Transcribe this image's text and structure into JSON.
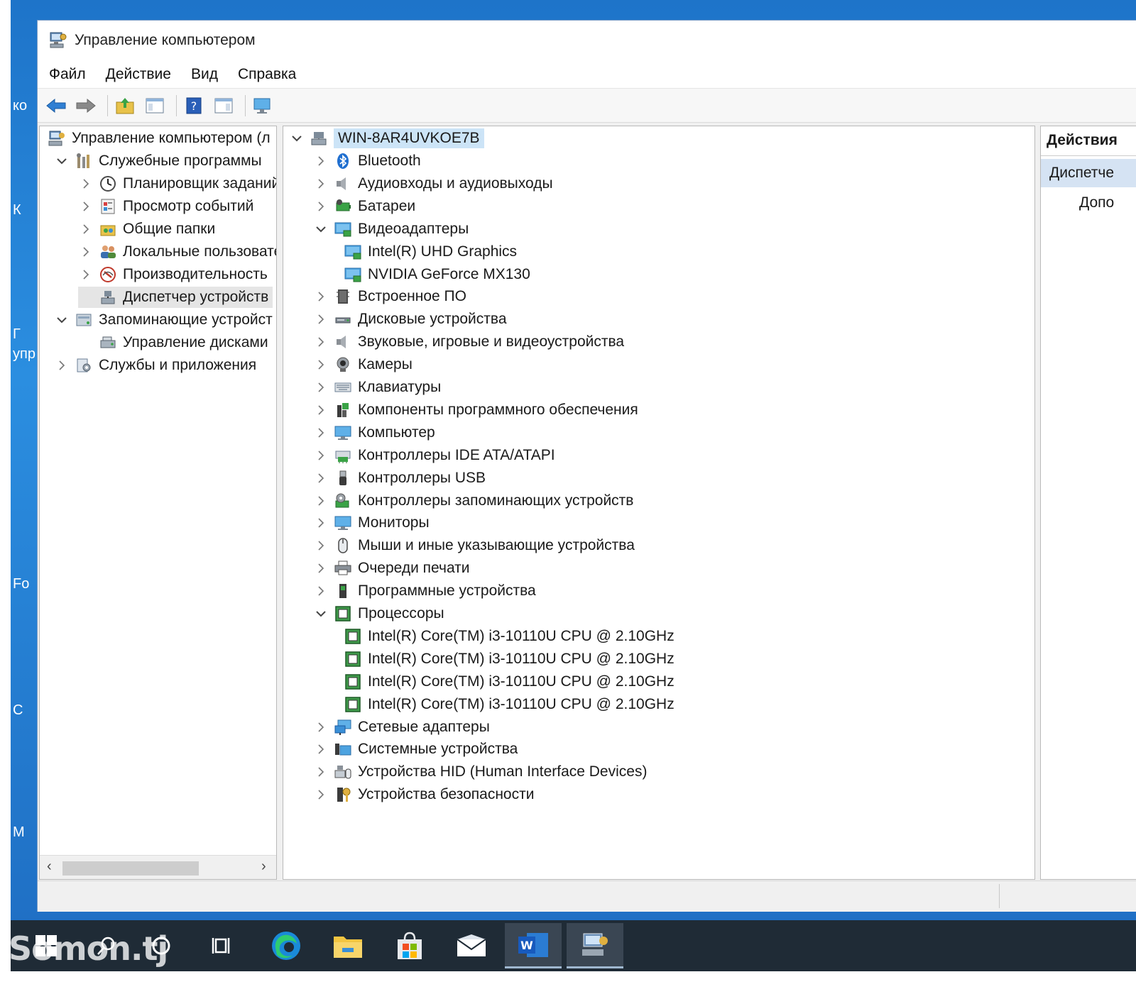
{
  "window": {
    "title": "Управление компьютером"
  },
  "menu": [
    "Файл",
    "Действие",
    "Вид",
    "Справка"
  ],
  "left_tree": [
    {
      "label": "Управление компьютером (л",
      "depth": 0,
      "expander": "none",
      "icon": "computer-management-icon"
    },
    {
      "label": "Служебные программы",
      "depth": 1,
      "expander": "expanded",
      "icon": "tools-icon"
    },
    {
      "label": "Планировщик заданий",
      "depth": 2,
      "expander": "collapsed",
      "icon": "clock-icon"
    },
    {
      "label": "Просмотр событий",
      "depth": 2,
      "expander": "collapsed",
      "icon": "event-viewer-icon"
    },
    {
      "label": "Общие папки",
      "depth": 2,
      "expander": "collapsed",
      "icon": "shared-folders-icon"
    },
    {
      "label": "Локальные пользовате",
      "depth": 2,
      "expander": "collapsed",
      "icon": "users-icon"
    },
    {
      "label": "Производительность",
      "depth": 2,
      "expander": "collapsed",
      "icon": "performance-icon"
    },
    {
      "label": "Диспетчер устройств",
      "depth": 2,
      "expander": "none",
      "icon": "device-manager-icon",
      "selected": true
    },
    {
      "label": "Запоминающие устройст",
      "depth": 1,
      "expander": "expanded",
      "icon": "storage-icon"
    },
    {
      "label": "Управление дисками",
      "depth": 2,
      "expander": "none",
      "icon": "disk-management-icon"
    },
    {
      "label": "Службы и приложения",
      "depth": 1,
      "expander": "collapsed",
      "icon": "services-icon"
    }
  ],
  "device_tree": {
    "root": "WIN-8AR4UVKOE7B",
    "items": [
      {
        "label": "Bluetooth",
        "depth": 1,
        "expander": "collapsed",
        "icon": "bluetooth-icon"
      },
      {
        "label": "Аудиовходы и аудиовыходы",
        "depth": 1,
        "expander": "collapsed",
        "icon": "speaker-icon"
      },
      {
        "label": "Батареи",
        "depth": 1,
        "expander": "collapsed",
        "icon": "battery-icon"
      },
      {
        "label": "Видеоадаптеры",
        "depth": 1,
        "expander": "expanded",
        "icon": "display-adapter-icon"
      },
      {
        "label": "Intel(R) UHD Graphics",
        "depth": 2,
        "expander": "none",
        "icon": "display-adapter-icon"
      },
      {
        "label": "NVIDIA GeForce MX130",
        "depth": 2,
        "expander": "none",
        "icon": "display-adapter-icon"
      },
      {
        "label": "Встроенное ПО",
        "depth": 1,
        "expander": "collapsed",
        "icon": "firmware-icon"
      },
      {
        "label": "Дисковые устройства",
        "depth": 1,
        "expander": "collapsed",
        "icon": "disk-drive-icon"
      },
      {
        "label": "Звуковые, игровые и видеоустройства",
        "depth": 1,
        "expander": "collapsed",
        "icon": "speaker-icon"
      },
      {
        "label": "Камеры",
        "depth": 1,
        "expander": "collapsed",
        "icon": "camera-icon"
      },
      {
        "label": "Клавиатуры",
        "depth": 1,
        "expander": "collapsed",
        "icon": "keyboard-icon"
      },
      {
        "label": "Компоненты программного обеспечения",
        "depth": 1,
        "expander": "collapsed",
        "icon": "software-component-icon"
      },
      {
        "label": "Компьютер",
        "depth": 1,
        "expander": "collapsed",
        "icon": "monitor-icon"
      },
      {
        "label": "Контроллеры IDE ATA/ATAPI",
        "depth": 1,
        "expander": "collapsed",
        "icon": "ide-controller-icon"
      },
      {
        "label": "Контроллеры USB",
        "depth": 1,
        "expander": "collapsed",
        "icon": "usb-icon"
      },
      {
        "label": "Контроллеры запоминающих устройств",
        "depth": 1,
        "expander": "collapsed",
        "icon": "storage-controller-icon"
      },
      {
        "label": "Мониторы",
        "depth": 1,
        "expander": "collapsed",
        "icon": "monitor-icon"
      },
      {
        "label": "Мыши и иные указывающие устройства",
        "depth": 1,
        "expander": "collapsed",
        "icon": "mouse-icon"
      },
      {
        "label": "Очереди печати",
        "depth": 1,
        "expander": "collapsed",
        "icon": "printer-icon"
      },
      {
        "label": "Программные устройства",
        "depth": 1,
        "expander": "collapsed",
        "icon": "software-device-icon"
      },
      {
        "label": "Процессоры",
        "depth": 1,
        "expander": "expanded",
        "icon": "cpu-icon"
      },
      {
        "label": "Intel(R) Core(TM) i3-10110U CPU @ 2.10GHz",
        "depth": 2,
        "expander": "none",
        "icon": "cpu-icon"
      },
      {
        "label": "Intel(R) Core(TM) i3-10110U CPU @ 2.10GHz",
        "depth": 2,
        "expander": "none",
        "icon": "cpu-icon"
      },
      {
        "label": "Intel(R) Core(TM) i3-10110U CPU @ 2.10GHz",
        "depth": 2,
        "expander": "none",
        "icon": "cpu-icon"
      },
      {
        "label": "Intel(R) Core(TM) i3-10110U CPU @ 2.10GHz",
        "depth": 2,
        "expander": "none",
        "icon": "cpu-icon"
      },
      {
        "label": "Сетевые адаптеры",
        "depth": 1,
        "expander": "collapsed",
        "icon": "network-adapter-icon"
      },
      {
        "label": "Системные устройства",
        "depth": 1,
        "expander": "collapsed",
        "icon": "system-devices-icon"
      },
      {
        "label": "Устройства HID (Human Interface Devices)",
        "depth": 1,
        "expander": "collapsed",
        "icon": "hid-icon"
      },
      {
        "label": "Устройства безопасности",
        "depth": 1,
        "expander": "collapsed",
        "icon": "security-device-icon"
      }
    ]
  },
  "actions": {
    "header": "Действия",
    "subheader": "Диспетче",
    "item": "Допо"
  },
  "desktop_fragments": [
    "ко",
    "К",
    "Г",
    "упр",
    "Fo",
    "С",
    "М"
  ],
  "watermark": "Somon.tj",
  "colors": {
    "desktop": "#1e74c9",
    "taskbar": "#1f2b36",
    "selection": "#cce4f7",
    "accent": "#2f7fd3"
  }
}
